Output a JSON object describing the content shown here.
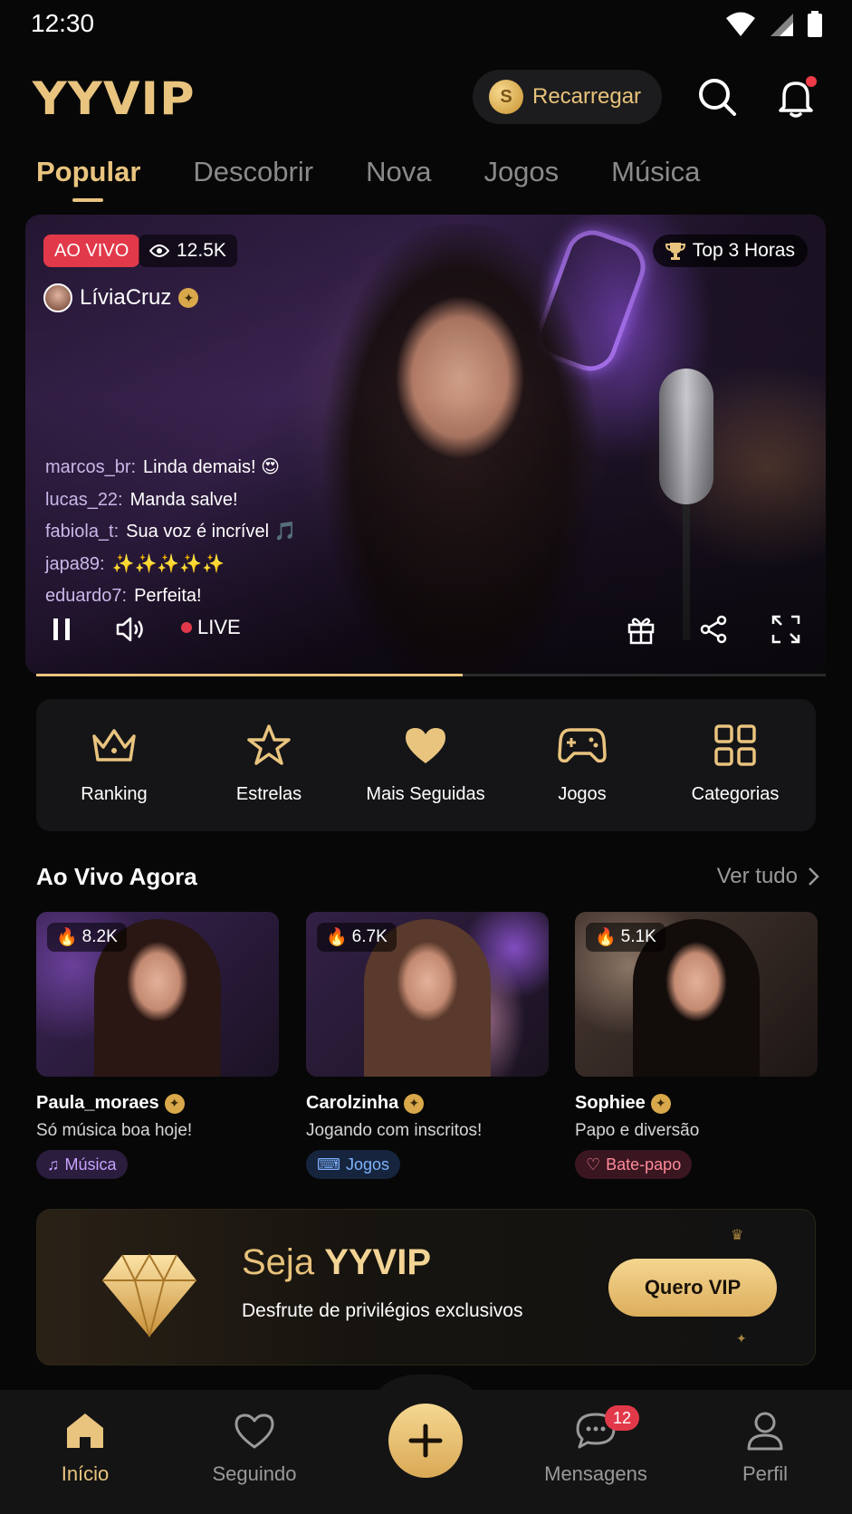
{
  "status_bar": {
    "time": "12:30"
  },
  "header": {
    "logo": "YYVIP",
    "recharge_label": "Recarregar",
    "coin_symbol": "S"
  },
  "tabs": [
    {
      "label": "Popular",
      "active": true
    },
    {
      "label": "Descobrir"
    },
    {
      "label": "Nova"
    },
    {
      "label": "Jogos"
    },
    {
      "label": "Música"
    }
  ],
  "hero": {
    "live_badge": "AO VIVO",
    "viewers": "12.5K",
    "ranking_badge": "Top 3 Horas",
    "streamer_name": "LíviaCruz",
    "chat": [
      {
        "user": "marcos_br:",
        "message": "Linda demais! 😍"
      },
      {
        "user": "lucas_22:",
        "message": "Manda salve!"
      },
      {
        "user": "fabiola_t:",
        "message": "Sua voz é incrível 🎵"
      },
      {
        "user": "japa89:",
        "message": "✨✨✨✨✨"
      },
      {
        "user": "eduardo7:",
        "message": "Perfeita!"
      }
    ],
    "live_label": "LIVE",
    "progress": 0.54
  },
  "quick_menu": [
    {
      "label": "Ranking",
      "icon": "crown-icon"
    },
    {
      "label": "Estrelas",
      "icon": "star-icon"
    },
    {
      "label": "Mais Seguidas",
      "icon": "heart-icon"
    },
    {
      "label": "Jogos",
      "icon": "gamepad-icon"
    },
    {
      "label": "Categorias",
      "icon": "grid-icon"
    }
  ],
  "live_now": {
    "title": "Ao Vivo Agora",
    "see_all": "Ver tudo",
    "cards": [
      {
        "heat": "8.2K",
        "name": "Paula_moraes",
        "desc": "Só música boa hoje!",
        "tag": "Música",
        "tag_color": "#b98cff"
      },
      {
        "heat": "6.7K",
        "name": "Carolzinha",
        "desc": "Jogando com inscritos!",
        "tag": "Jogos",
        "tag_color": "#6fa8ff"
      },
      {
        "heat": "5.1K",
        "name": "Sophiee",
        "desc": "Papo e diversão",
        "tag": "Bate-papo",
        "tag_color": "#ff7a8c"
      }
    ]
  },
  "vip_banner": {
    "title_prefix": "Seja",
    "title_brand": "YYVIP",
    "subtitle": "Desfrute de privilégios exclusivos",
    "button": "Quero VIP"
  },
  "bottom_nav": [
    {
      "label": "Início",
      "icon": "home-icon",
      "active": true
    },
    {
      "label": "Seguindo",
      "icon": "heart-outline-icon"
    },
    {
      "label": "Mensagens",
      "icon": "chat-icon",
      "badge": "12"
    },
    {
      "label": "Perfil",
      "icon": "user-icon"
    }
  ],
  "colors": {
    "accent": "#e9c47f",
    "live": "#e2394a",
    "background": "#070707"
  }
}
